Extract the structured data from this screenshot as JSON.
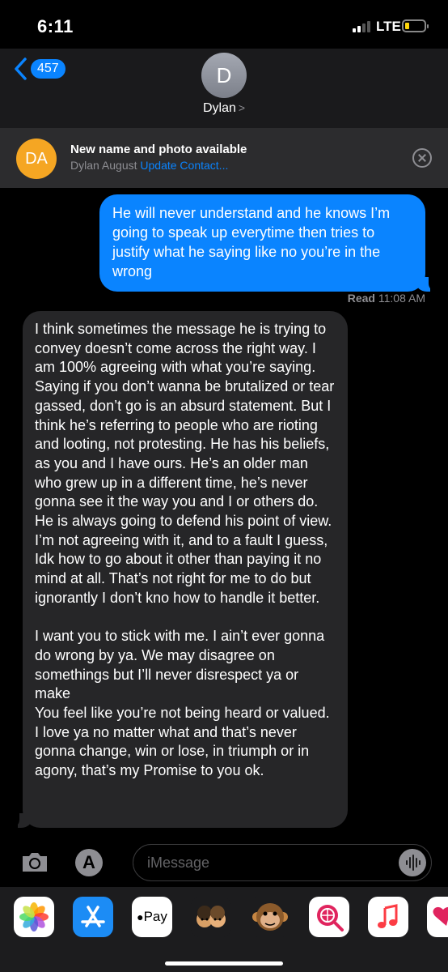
{
  "status": {
    "time": "6:11",
    "network": "LTE"
  },
  "header": {
    "back_count": "457",
    "avatar_initial": "D",
    "name": "Dylan",
    "caret": ">"
  },
  "banner": {
    "initials": "DA",
    "title": "New name and photo available",
    "name": "Dylan August",
    "link": "Update Contact..."
  },
  "messages": {
    "outgoing": "He will never understand and he knows I’m going to speak up everytime then tries to justify what he saying like no you’re in the wrong",
    "read_label": "Read",
    "read_time": "11:08 AM",
    "incoming_p1": "I think sometimes the message he is trying to convey doesn’t come across the right way. I am 100% agreeing with what you’re saying. Saying if you don’t wanna be brutalized or tear gassed, don’t go is an absurd statement. But I think he’s referring to people who are rioting and looting, not protesting. He has his beliefs, as you and I have ours. He’s an older man who grew up in a different time, he’s never gonna see it the way you and I or others do. He is always going to defend his point of view. I’m not agreeing with it, and to a fault I guess, Idk how to go about it other than paying it no mind at all. That’s not right for me to do but ignorantly I don’t kno how to handle it better.",
    "incoming_p2a": "I want you to  stick with me. I ain’t ever gonna do wrong by ya. We may disagree on somethings but I’ll never disrespect ya or make",
    "incoming_p2b": "You feel like you’re not being heard or valued. I love ya no matter what and that’s never gonna change, win or lose, in triumph or in agony, that’s  my Promise to you ok."
  },
  "compose": {
    "placeholder": "iMessage",
    "appstore_glyph": "A"
  },
  "drawer": {
    "applepay_label": "Pay"
  },
  "colors": {
    "blue": "#0a84ff",
    "bubble_gray": "#262628",
    "banner_orange": "#f5a623"
  }
}
